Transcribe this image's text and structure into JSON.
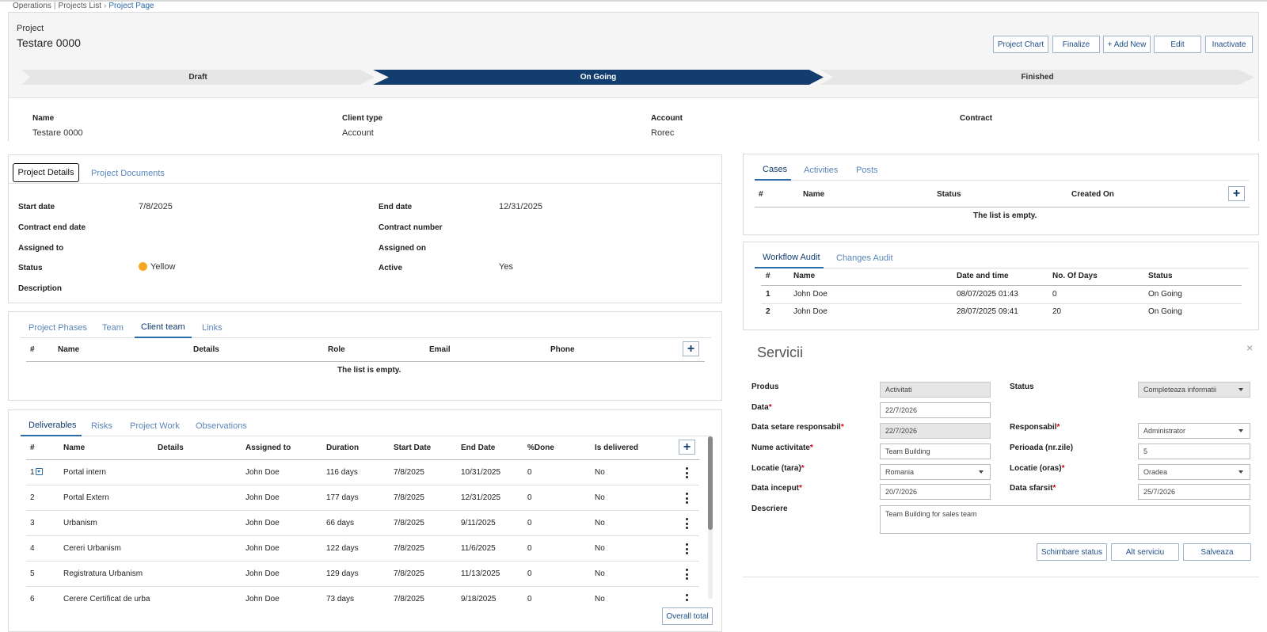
{
  "breadcrumb": {
    "items": [
      "Operations",
      "Projects List"
    ],
    "current": "Project Page"
  },
  "header": {
    "label": "Project",
    "title": "Testare 0000",
    "buttons": [
      "Project Chart",
      "Finalize",
      "+ Add New",
      "Edit",
      "Inactivate"
    ],
    "stages": [
      "Draft",
      "On Going",
      "Finished"
    ],
    "active_stage": "On Going",
    "fields": [
      {
        "label": "Name",
        "value": "Testare 0000"
      },
      {
        "label": "Client type",
        "value": "Account"
      },
      {
        "label": "Account",
        "value": "Rorec"
      },
      {
        "label": "Contract",
        "value": ""
      }
    ]
  },
  "details": {
    "tabs": [
      "Project Details",
      "Project Documents"
    ],
    "left": [
      {
        "label": "Start date",
        "value": "7/8/2025"
      },
      {
        "label": "Contract end date",
        "value": ""
      },
      {
        "label": "Assigned to",
        "value": ""
      },
      {
        "label": "Status",
        "value": "Yellow"
      },
      {
        "label": "Description",
        "value": ""
      }
    ],
    "right": [
      {
        "label": "End date",
        "value": "12/31/2025"
      },
      {
        "label": "Contract number",
        "value": ""
      },
      {
        "label": "Assigned on",
        "value": ""
      },
      {
        "label": "Active",
        "value": "Yes"
      }
    ],
    "status_color": "#f5a623"
  },
  "team": {
    "tabs": [
      "Project Phases",
      "Team",
      "Client team",
      "Links"
    ],
    "active_tab": "Client team",
    "columns": [
      "#",
      "Name",
      "Details",
      "Role",
      "Email",
      "Phone"
    ],
    "empty": "The list is empty."
  },
  "deliverables": {
    "tabs": [
      "Deliverables",
      "Risks",
      "Project Work",
      "Observations"
    ],
    "active_tab": "Deliverables",
    "columns": [
      "#",
      "Name",
      "Details",
      "Assigned to",
      "Duration",
      "Start Date",
      "End Date",
      "%Done",
      "Is delivered"
    ],
    "rows": [
      [
        "1",
        "Portal intern",
        "",
        "John Doe",
        "116 days",
        "7/8/2025",
        "10/31/2025",
        "0",
        "No"
      ],
      [
        "2",
        "Portal Extern",
        "",
        "John Doe",
        "177 days",
        "7/8/2025",
        "12/31/2025",
        "0",
        "No"
      ],
      [
        "3",
        "Urbanism",
        "",
        "John Doe",
        "66 days",
        "7/8/2025",
        "9/11/2025",
        "0",
        "No"
      ],
      [
        "4",
        "Cereri Urbanism",
        "",
        "John Doe",
        "122 days",
        "7/8/2025",
        "11/6/2025",
        "0",
        "No"
      ],
      [
        "5",
        "Registratura Urbanism",
        "",
        "John Doe",
        "129 days",
        "7/8/2025",
        "11/13/2025",
        "0",
        "No"
      ],
      [
        "6",
        "Cerere Certificat de urba",
        "",
        "John Doe",
        "73 days",
        "7/8/2025",
        "9/18/2025",
        "0",
        "No"
      ]
    ],
    "overall_button": "Overall total"
  },
  "cases": {
    "tabs": [
      "Cases",
      "Activities",
      "Posts"
    ],
    "active_tab": "Cases",
    "columns": [
      "#",
      "Name",
      "Status",
      "Created On"
    ],
    "empty": "The list is empty."
  },
  "audit": {
    "tabs": [
      "Workflow Audit",
      "Changes Audit"
    ],
    "active_tab": "Workflow Audit",
    "columns": [
      "#",
      "Name",
      "Date and time",
      "No. Of Days",
      "Status"
    ],
    "rows": [
      [
        "1",
        "John Doe",
        "08/07/2025 01:43",
        "0",
        "On Going"
      ],
      [
        "2",
        "John Doe",
        "28/07/2025 09:41",
        "20",
        "On Going"
      ]
    ]
  },
  "servicii": {
    "title": "Servicii",
    "close": "×",
    "fields": {
      "produs": {
        "label": "Produs",
        "value": "Activitati"
      },
      "data": {
        "label": "Data",
        "value": "22/7/2026"
      },
      "data_setare": {
        "label": "Data setare responsabil",
        "value": "22/7/2026"
      },
      "nume": {
        "label": "Nume activitate",
        "value": "Team Building"
      },
      "locatie_tara": {
        "label": "Locatie (tara)",
        "value": "Romania"
      },
      "data_inceput": {
        "label": "Data inceput",
        "value": "20/7/2026"
      },
      "descriere": {
        "label": "Descriere",
        "value": "Team Building for sales team"
      },
      "status": {
        "label": "Status",
        "value": "Completeaza informatii"
      },
      "responsabil": {
        "label": "Responsabil",
        "value": "Administrator"
      },
      "perioada": {
        "label": "Perioada (nr.zile)",
        "value": "5"
      },
      "locatie_oras": {
        "label": "Locatie (oras)",
        "value": "Oradea"
      },
      "data_sfarsit": {
        "label": "Data sfarsit",
        "value": "25/7/2026"
      }
    },
    "required_mark": "*",
    "buttons": [
      "Schimbare status",
      "Alt serviciu",
      "Salveaza"
    ]
  }
}
